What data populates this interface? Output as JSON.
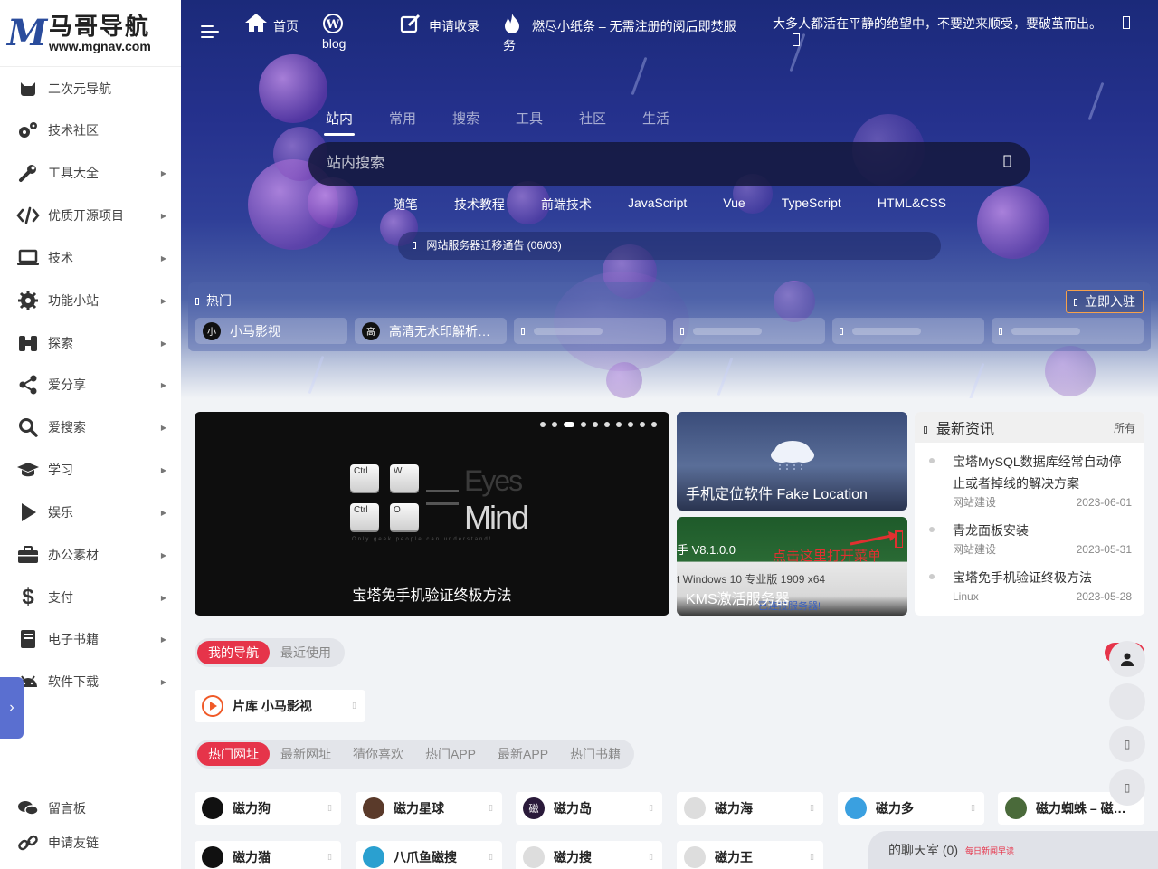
{
  "logo": {
    "mark": "M",
    "cn": "马哥导航",
    "en": "www.mgnav.com"
  },
  "sidebar": {
    "items": [
      {
        "label": "二次元导航",
        "icon": "cat-icon"
      },
      {
        "label": "技术社区",
        "icon": "gears-icon"
      },
      {
        "label": "工具大全",
        "icon": "wrench-icon"
      },
      {
        "label": "优质开源项目",
        "icon": "code-icon"
      },
      {
        "label": "技术",
        "icon": "laptop-icon"
      },
      {
        "label": "功能小站",
        "icon": "gear-icon"
      },
      {
        "label": "探索",
        "icon": "binoculars-icon"
      },
      {
        "label": "爱分享",
        "icon": "share-icon"
      },
      {
        "label": "爱搜索",
        "icon": "search-icon"
      },
      {
        "label": "学习",
        "icon": "graduation-cap-icon"
      },
      {
        "label": "娱乐",
        "icon": "play-icon"
      },
      {
        "label": "办公素材",
        "icon": "briefcase-icon"
      },
      {
        "label": "支付",
        "icon": "dollar-icon"
      },
      {
        "label": "电子书籍",
        "icon": "book-icon"
      },
      {
        "label": "软件下载",
        "icon": "android-icon"
      }
    ],
    "bottom": [
      {
        "label": "留言板",
        "icon": "comments-icon"
      },
      {
        "label": "申请友链",
        "icon": "link-icon"
      }
    ]
  },
  "topbar": {
    "home": "首页",
    "blog": "blog",
    "apply": "申请收录",
    "burn": "燃尽小纸条 – 无需注册的阅后即焚服务",
    "motto": "大多人都活在平静的绝望中，不要逆来顺受，要破茧而出。"
  },
  "search": {
    "tabs": [
      "站内",
      "常用",
      "搜索",
      "工具",
      "社区",
      "生活"
    ],
    "active_tab": "站内",
    "placeholder": "站内搜索",
    "keywords": [
      "随笔",
      "技术教程",
      "前端技术",
      "JavaScript",
      "Vue",
      "TypeScript",
      "HTML&CSS"
    ],
    "notice": "网站服务器迁移通告 (06/03)"
  },
  "hot": {
    "label": "热门",
    "settle_button": "立即入驻",
    "items": [
      {
        "name": "小马影视",
        "avatar": "小"
      },
      {
        "name": "高清无水印解析…",
        "avatar": "高"
      }
    ]
  },
  "slider": {
    "caption": "宝塔免手机验证终极方法",
    "keys": [
      "Ctrl",
      "W",
      "Ctrl",
      "O"
    ],
    "brand_top": "Eyes",
    "brand_bottom": "Mind",
    "tagline": "Only geek people can understand!",
    "dot_count": 10,
    "active_dot": 3
  },
  "cards": [
    {
      "caption": "手机定位软件 Fake Location"
    },
    {
      "caption": "KMS激活服务器",
      "overlay_1": "手 V8.1.0.0",
      "overlay_2": "点击这里打开菜单",
      "overlay_3": "t Windows 10 专业版 1909 x64",
      "overlay_4": "已连接服务器!"
    }
  ],
  "news": {
    "title": "最新资讯",
    "more": "所有",
    "items": [
      {
        "title": "宝塔MySQL数据库经常自动停止或者掉线的解决方案",
        "category": "网站建设",
        "date": "2023-06-01"
      },
      {
        "title": "青龙面板安装",
        "category": "网站建设",
        "date": "2023-05-31"
      },
      {
        "title": "宝塔免手机验证终极方法",
        "category": "Linux",
        "date": "2023-05-28"
      }
    ]
  },
  "my_nav": {
    "tabs": [
      "我的导航",
      "最近使用"
    ],
    "item": "片库 小马影视"
  },
  "sites": {
    "tabs": [
      "热门网址",
      "最新网址",
      "猜你喜欢",
      "热门APP",
      "最新APP",
      "热门书籍"
    ],
    "row1": [
      {
        "name": "磁力狗",
        "avatar": "",
        "color": "#111111"
      },
      {
        "name": "磁力星球",
        "avatar": "",
        "color": "#5a3a2a"
      },
      {
        "name": "磁力岛",
        "avatar": "磁",
        "color": "#2a1a3a"
      },
      {
        "name": "磁力海",
        "avatar": "",
        "color": "#dddddd"
      },
      {
        "name": "磁力多",
        "avatar": "",
        "color": "#3aa0e0"
      },
      {
        "name": "磁力蜘蛛 – 磁…",
        "avatar": "",
        "color": "#4a6a3a"
      }
    ],
    "row2": [
      {
        "name": "磁力猫",
        "avatar": "",
        "color": "#111111"
      },
      {
        "name": "八爪鱼磁搜",
        "avatar": "",
        "color": "#2aa0d0"
      },
      {
        "name": "磁力搜",
        "avatar": "",
        "color": "#dddddd"
      },
      {
        "name": "磁力王",
        "avatar": "",
        "color": "#dddddd"
      }
    ]
  },
  "chat": {
    "label": "的聊天室 (0)",
    "link": "每日新闻早读"
  },
  "colors": {
    "accent": "#e6344a",
    "hero": "#25318d",
    "sidebar_tab": "#5a6fd0"
  }
}
